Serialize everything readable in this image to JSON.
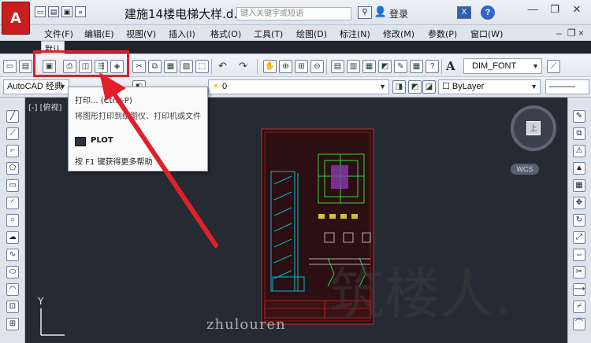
{
  "app": {
    "logo_letter": "A",
    "doc_title": "建施14楼电梯大样.d...",
    "search_placeholder": "键入关键字或短语",
    "login": "登录"
  },
  "menu": [
    "文件(F)",
    "编辑(E)",
    "视图(V)",
    "插入(I)",
    "格式(O)",
    "工具(T)",
    "绘图(D)",
    "标注(N)",
    "修改(M)",
    "参数(P)",
    "窗口(W)"
  ],
  "tab": {
    "label": "默认"
  },
  "toolbar": {
    "dim_font": "DIM_FONT"
  },
  "layer_bar": {
    "workspace": "AutoCAD 经典",
    "layer": "0",
    "color": "ByLayer"
  },
  "canvas": {
    "view_label": "[-] [俯视]",
    "wcs": "WCS",
    "viewcube_face": "上",
    "y_axis": "Y"
  },
  "tooltip": {
    "title": "打印... (Ctrl+P)",
    "desc": "将图形打印到绘图仪、打印机或文件",
    "command": "PLOT",
    "f1_hint": "按 F1 键获得更多帮助"
  },
  "watermark": {
    "latin": "zhulouren",
    "chinese": "筑楼人."
  },
  "colors": {
    "highlight": "#e2202a",
    "canvas": "#262b33",
    "logo": "#c81e1e"
  }
}
